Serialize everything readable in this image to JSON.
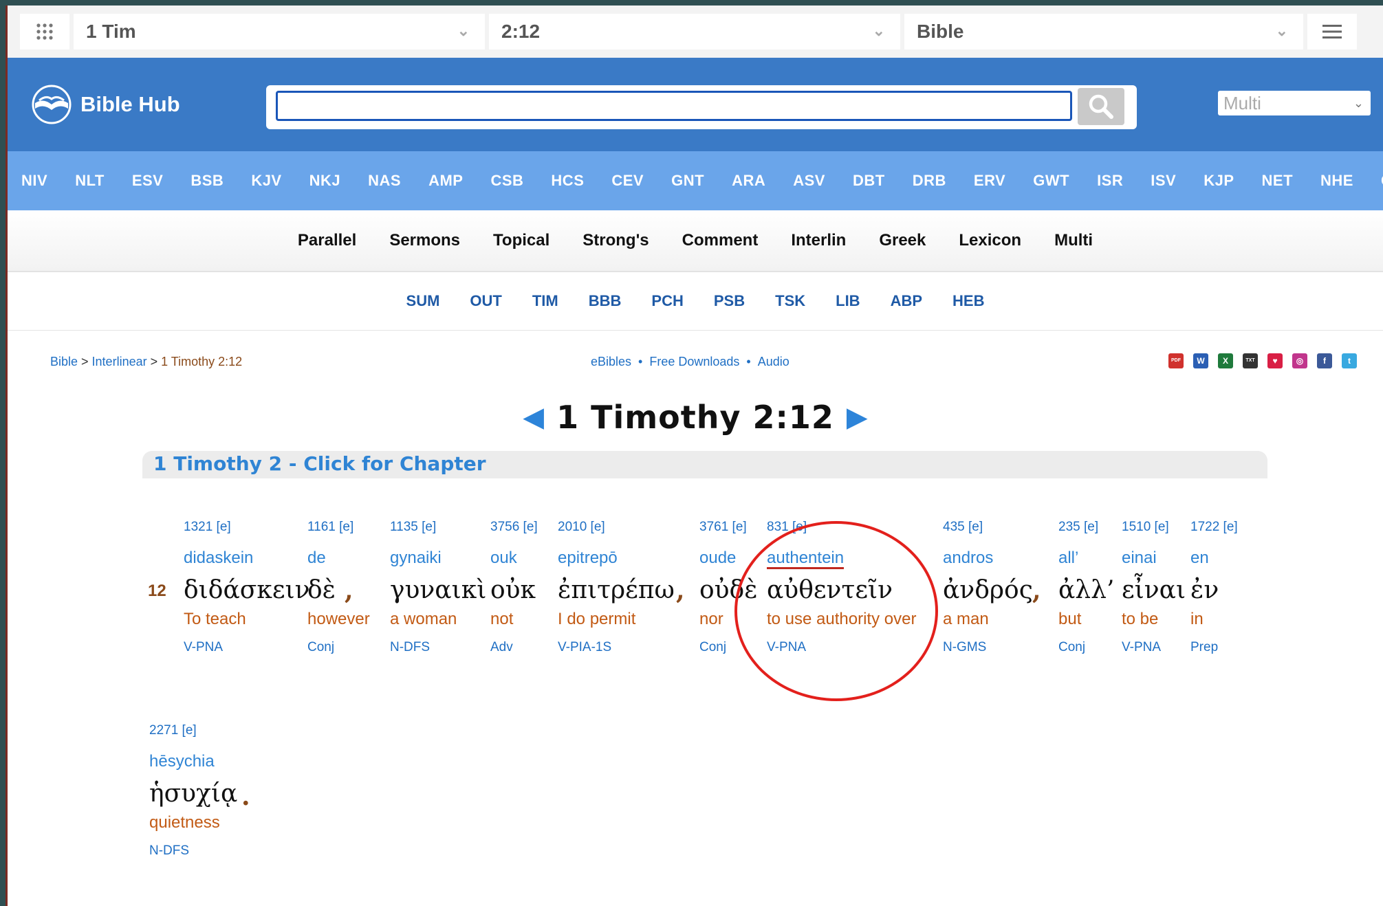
{
  "topbar": {
    "book": "1 Tim",
    "verse": "2:12",
    "version": "Bible"
  },
  "header": {
    "logo_text": "Bible Hub",
    "search_value": "",
    "multi_select": "Multi"
  },
  "versions": [
    "NIV",
    "NLT",
    "ESV",
    "BSB",
    "KJV",
    "NKJ",
    "NAS",
    "AMP",
    "CSB",
    "HCS",
    "CEV",
    "GNT",
    "ARA",
    "ASV",
    "DBT",
    "DRB",
    "ERV",
    "GWT",
    "ISR",
    "ISV",
    "KJP",
    "NET",
    "NHE",
    "OJB"
  ],
  "tools": [
    "Parallel",
    "Sermons",
    "Topical",
    "Strong's",
    "Comment",
    "Interlin",
    "Greek",
    "Lexicon",
    "Multi"
  ],
  "commentaries": [
    "SUM",
    "OUT",
    "TIM",
    "BBB",
    "PCH",
    "PSB",
    "TSK",
    "LIB",
    "ABP",
    "HEB"
  ],
  "breadcrumb": {
    "bible": "Bible",
    "sep1": " > ",
    "interlinear": "Interlinear",
    "sep2": " > ",
    "current": "1 Timothy 2:12"
  },
  "links": {
    "ebibles": "eBibles",
    "downloads": "Free Downloads",
    "audio": "Audio",
    "bullet": "•"
  },
  "share_icons": [
    {
      "name": "pdf-icon",
      "label": "PDF",
      "color": "#d0312d"
    },
    {
      "name": "word-icon",
      "label": "W",
      "color": "#2b5fb4"
    },
    {
      "name": "excel-icon",
      "label": "X",
      "color": "#1f7a3c"
    },
    {
      "name": "txt-icon",
      "label": "TXT",
      "color": "#333333"
    },
    {
      "name": "heart-icon",
      "label": "♥",
      "color": "#d91f45"
    },
    {
      "name": "instagram-icon",
      "label": "◎",
      "color": "#c1358c"
    },
    {
      "name": "facebook-icon",
      "label": "f",
      "color": "#3b5998"
    },
    {
      "name": "twitter-icon",
      "label": "t",
      "color": "#39a9e0"
    }
  ],
  "verse": {
    "title": "1 Timothy 2:12",
    "chapter_link": "1 Timothy 2 - Click for Chapter",
    "number": "12",
    "words": [
      {
        "strong": "1321 [e]",
        "translit": "didaskein",
        "greek": "διδάσκειν",
        "english": "To teach",
        "pos": "V-PNA"
      },
      {
        "strong": "1161 [e]",
        "translit": "de",
        "greek": "δὲ",
        "english": "however",
        "pos": "Conj"
      },
      {
        "strong": "1135 [e]",
        "translit": "gynaiki",
        "greek": "γυναικὶ",
        "english": "a woman",
        "pos": "N-DFS"
      },
      {
        "strong": "3756 [e]",
        "translit": "ouk",
        "greek": "οὐκ",
        "english": "not",
        "pos": "Adv"
      },
      {
        "strong": "2010 [e]",
        "translit": "epitrepō",
        "greek": "ἐπιτρέπω",
        "english": "I do permit",
        "pos": "V-PIA-1S"
      },
      {
        "strong": "3761 [e]",
        "translit": "oude",
        "greek": "οὐδὲ",
        "english": "nor",
        "pos": "Conj"
      },
      {
        "strong": "831 [e]",
        "translit": "authentein",
        "greek": "αὐθεντεῖν",
        "english": "to use authority over",
        "pos": "V-PNA"
      },
      {
        "strong": "435 [e]",
        "translit": "andros",
        "greek": "ἀνδρός",
        "english": "a man",
        "pos": "N-GMS"
      },
      {
        "strong": "235 [e]",
        "translit": "all’",
        "greek": "ἀλλ’",
        "english": "but",
        "pos": "Conj"
      },
      {
        "strong": "1510 [e]",
        "translit": "einai",
        "greek": "εἶναι",
        "english": "to be",
        "pos": "V-PNA"
      },
      {
        "strong": "1722 [e]",
        "translit": "en",
        "greek": "ἐν",
        "english": "in",
        "pos": "Prep"
      },
      {
        "strong": "2271 [e]",
        "translit": "hēsychia",
        "greek": "ἡσυχίᾳ",
        "english": "quietness",
        "pos": "N-DFS"
      }
    ],
    "punct": {
      "comma": ",",
      "period": "."
    }
  },
  "colors": {
    "header": "#3a7ac6",
    "versions_bar": "#6aa5ea",
    "annotation": "#e3201c",
    "english": "#c25a14"
  }
}
